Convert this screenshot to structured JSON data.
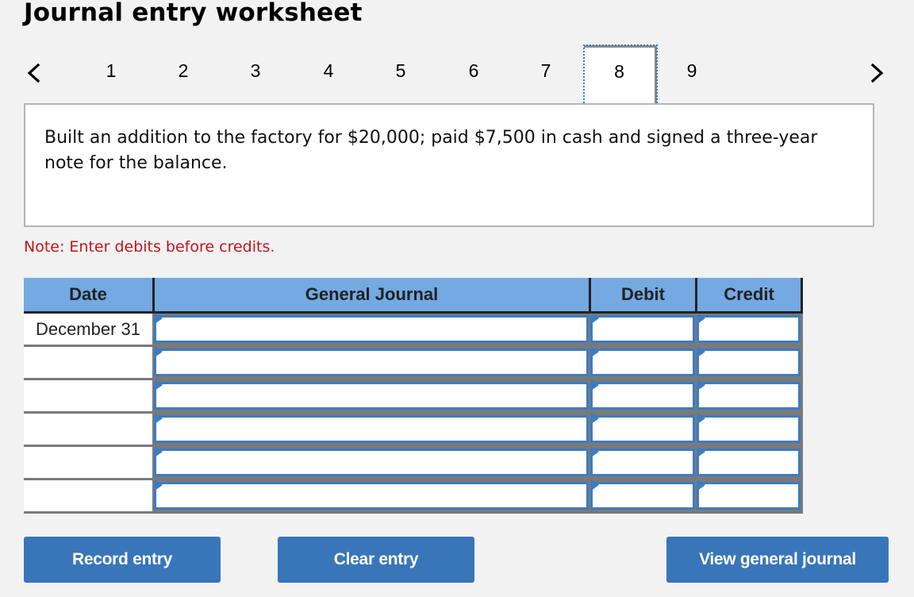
{
  "page": {
    "title": "Journal entry worksheet"
  },
  "pager": {
    "prev_icon": "chevron-left-icon",
    "next_icon": "chevron-right-icon",
    "tabs": [
      "1",
      "2",
      "3",
      "4",
      "5",
      "6",
      "7",
      "8",
      "9"
    ],
    "active_tab": "8"
  },
  "question": {
    "text": "Built an addition to the factory for $20,000; paid $7,500 in cash and signed a three-year note for the balance."
  },
  "note": "Note: Enter debits before credits.",
  "journal": {
    "columns": [
      "Date",
      "General Journal",
      "Debit",
      "Credit"
    ],
    "rows": [
      {
        "date": "December 31",
        "account": "",
        "debit": "",
        "credit": ""
      },
      {
        "date": "",
        "account": "",
        "debit": "",
        "credit": ""
      },
      {
        "date": "",
        "account": "",
        "debit": "",
        "credit": ""
      },
      {
        "date": "",
        "account": "",
        "debit": "",
        "credit": ""
      },
      {
        "date": "",
        "account": "",
        "debit": "",
        "credit": ""
      },
      {
        "date": "",
        "account": "",
        "debit": "",
        "credit": ""
      }
    ],
    "input_accent_color": "#3d7cc0",
    "header_color": "#74a9e2"
  },
  "buttons": {
    "record": "Record entry",
    "clear": "Clear entry",
    "view": "View general journal",
    "color": "#3876b9"
  }
}
